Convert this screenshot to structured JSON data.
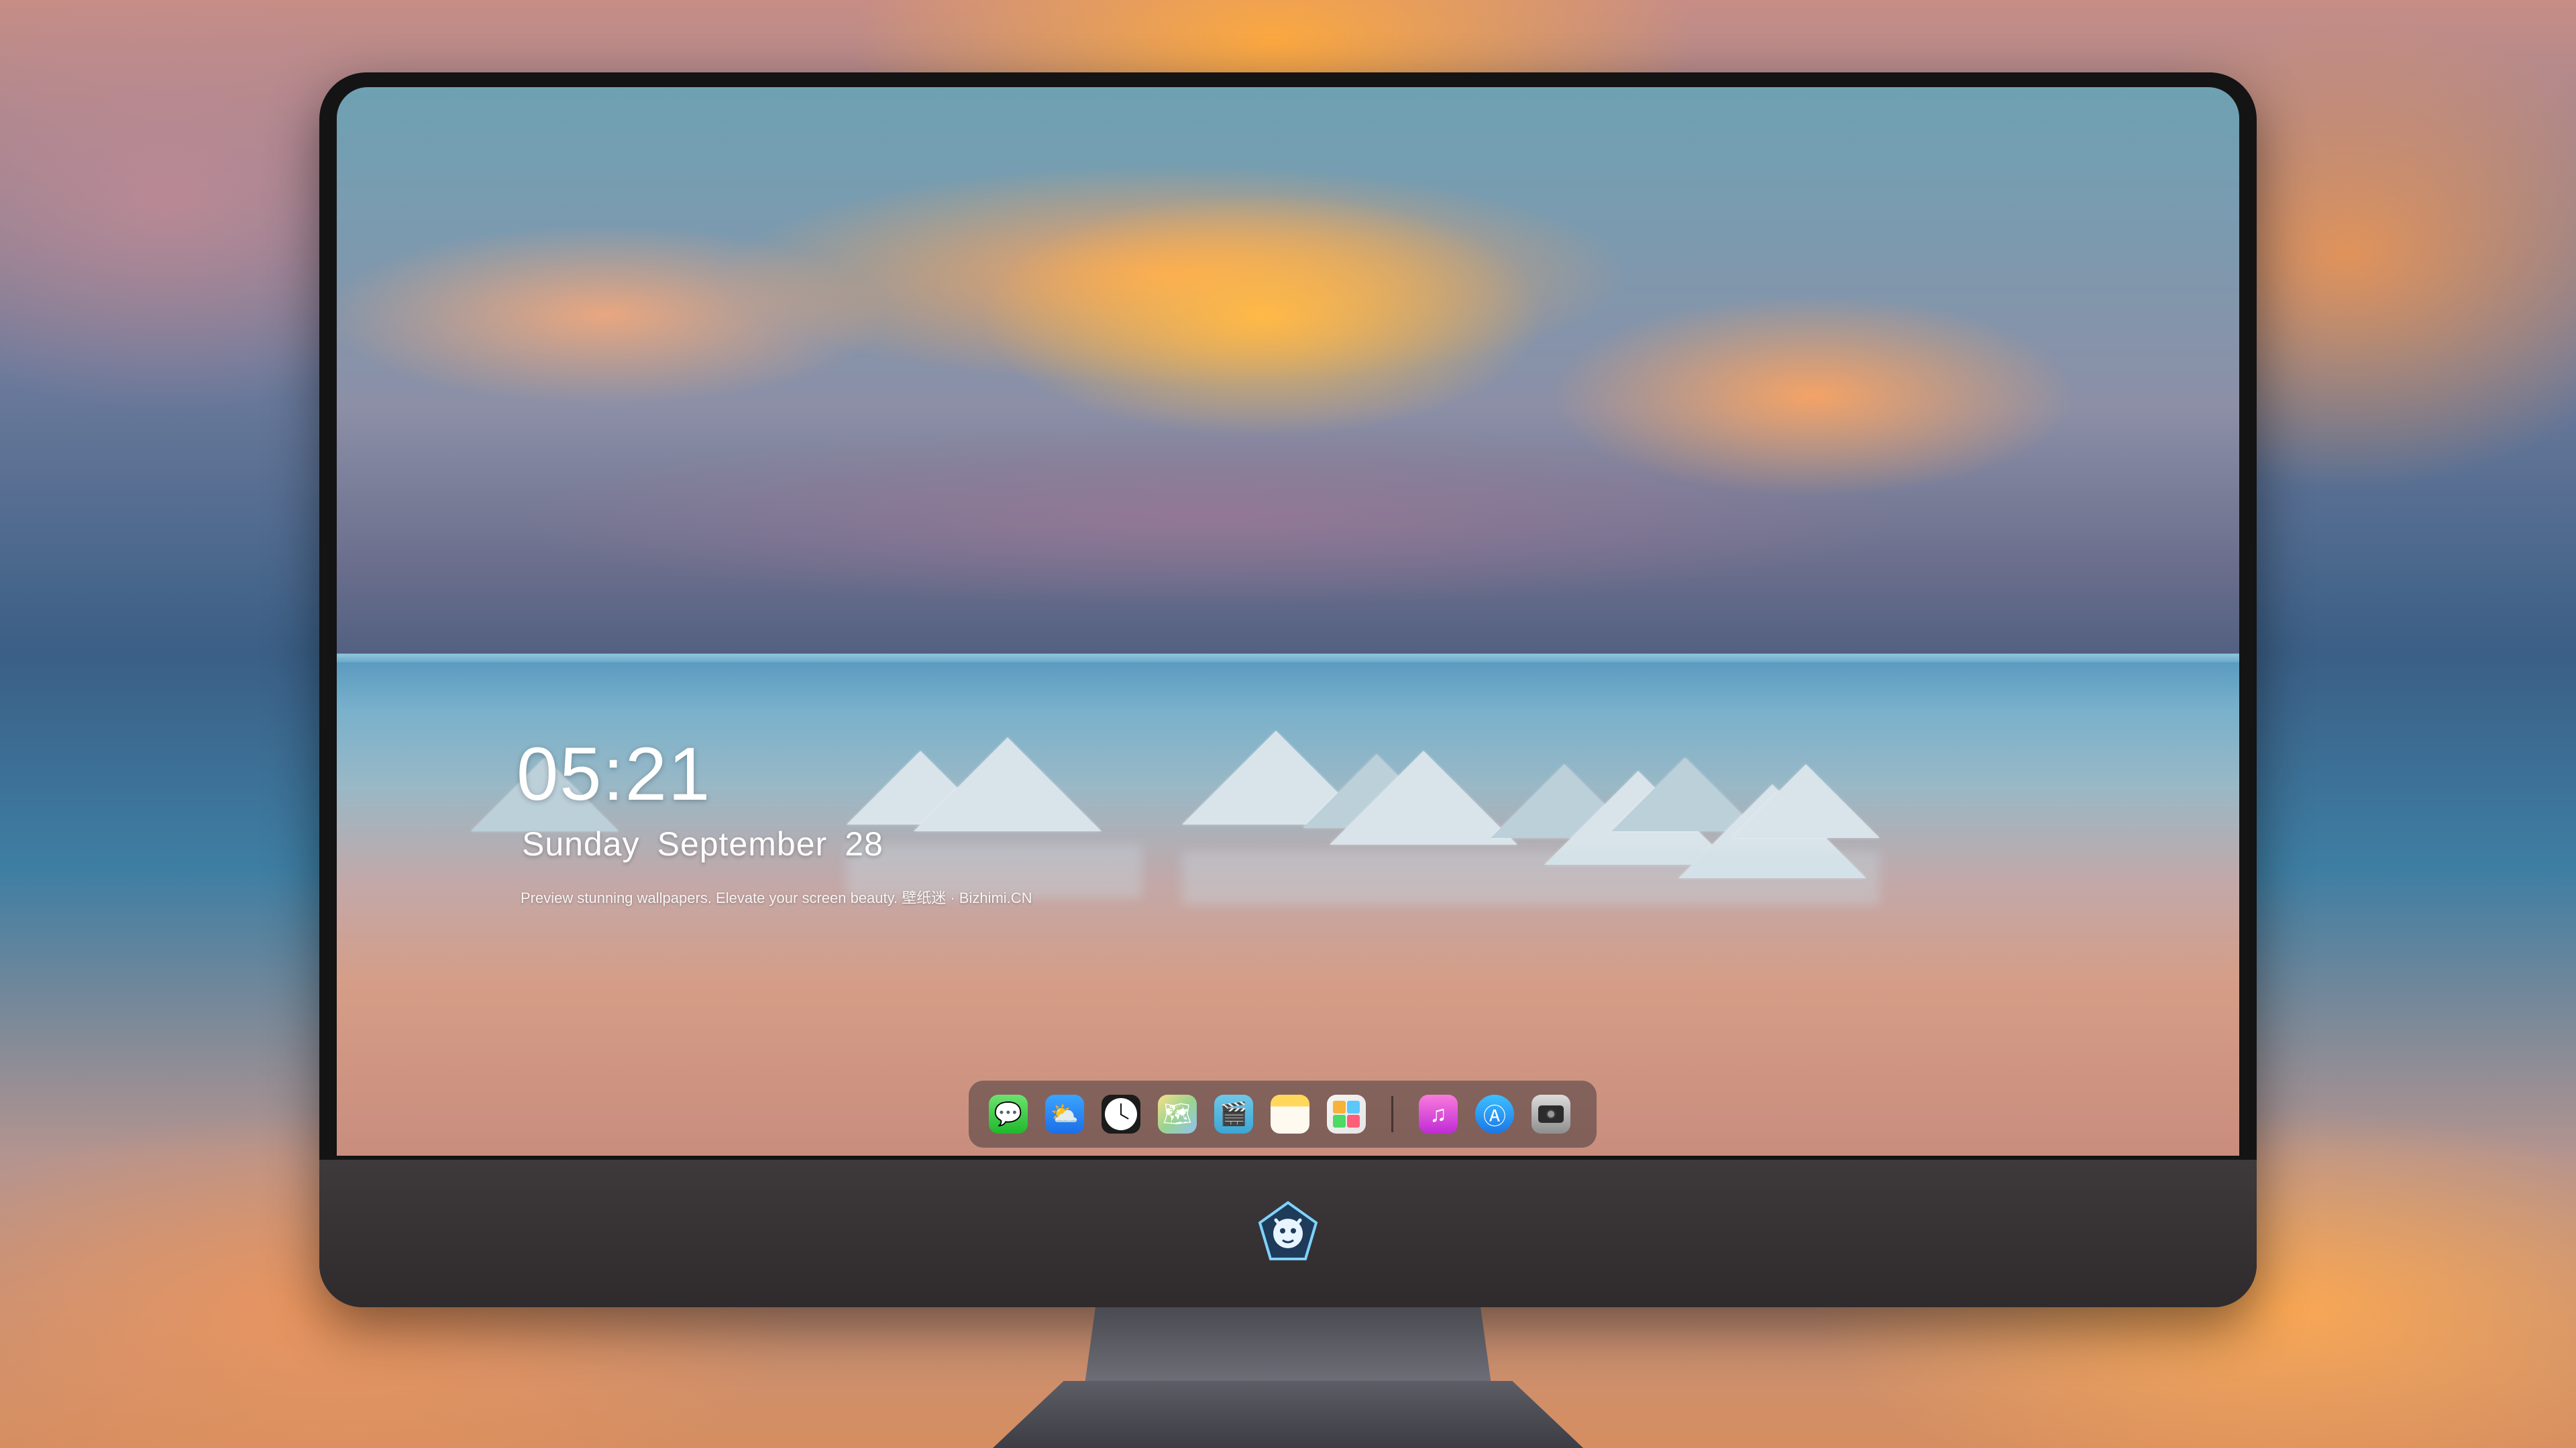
{
  "lock_screen": {
    "time": "05:21",
    "weekday": "Sunday",
    "month": "September",
    "day": "28",
    "tagline": "Preview stunning wallpapers. Elevate your screen beauty. 壁纸迷 · Bizhimi.CN"
  },
  "dock": {
    "apps": [
      {
        "name": "messages-icon",
        "glyph": "💬"
      },
      {
        "name": "weather-icon",
        "glyph": "⛅"
      },
      {
        "name": "clock-icon",
        "glyph": ""
      },
      {
        "name": "maps-icon",
        "glyph": "🗺"
      },
      {
        "name": "video-clapper-icon",
        "glyph": "🎬"
      },
      {
        "name": "notes-icon",
        "glyph": ""
      },
      {
        "name": "photos-icon",
        "glyph": ""
      },
      {
        "name": "music-icon",
        "glyph": "♫"
      },
      {
        "name": "app-store-icon",
        "glyph": "Ⓐ"
      },
      {
        "name": "camera-icon",
        "glyph": ""
      }
    ]
  },
  "colors": {
    "bezel": "#141414",
    "chin": "#3a3638",
    "stand": "#5d5d66",
    "dock_bg": "rgba(70,58,60,0.55)"
  }
}
